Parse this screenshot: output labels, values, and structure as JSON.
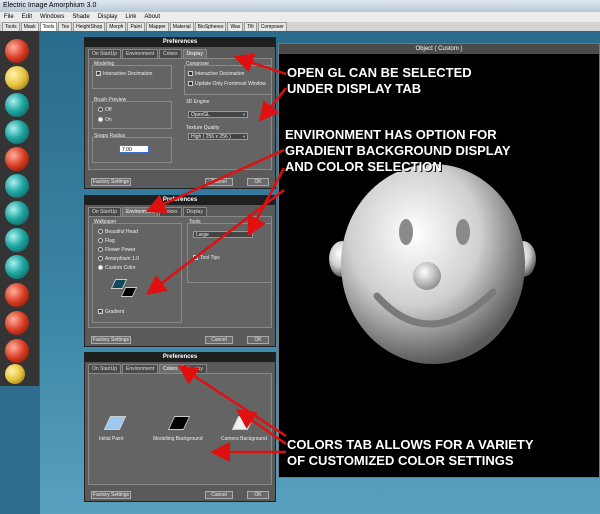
{
  "window": {
    "title": "Electric Image Amorphium 3.0"
  },
  "menu": [
    "File",
    "Edit",
    "Windows",
    "Shade",
    "Display",
    "Link",
    "About"
  ],
  "toolbar_tabs": [
    "Tools",
    "Mask",
    "Tools",
    "Tex",
    "HeightShop",
    "Morph",
    "Paint",
    "Mapper",
    "Material",
    "BioSpheres",
    "Wax",
    "Tilt",
    "Composer"
  ],
  "viewport": {
    "title": "Object ( Custom )"
  },
  "dialog_title": "Preferences",
  "tabs": {
    "startup": "On StartUp",
    "environment": "Environment",
    "colors": "Colors",
    "display": "Display"
  },
  "display_panel": {
    "modeling_label": "Modeling",
    "interactive_decimation": "Interactive Decimation",
    "composer_label": "Composer",
    "update_frontmost": "Update Only Frontmost Window",
    "brush_preview_label": "Brush Preview",
    "off": "Off",
    "on": "On",
    "engine_label": "3D Engine",
    "engine_value": "OpenGL",
    "texture_label": "Texture Quality",
    "texture_value": "High ( 256 x 256 )",
    "snaps_label": "Snaps Radius",
    "snaps_value": "7.00"
  },
  "environment_panel": {
    "wallpaper_label": "Wallpaper",
    "options": [
      "Beautiful Head",
      "Flag",
      "Flower Power",
      "Amorphium 1.0",
      "Custom Color"
    ],
    "gradient": "Gradient",
    "tools_label": "Tools",
    "tools_value": "Large",
    "tool_tips": "Tool Tips"
  },
  "colors_panel": {
    "items": [
      "Initial Paint",
      "Modelling Background",
      "Camera Background"
    ]
  },
  "buttons": {
    "factory": "Factory Settings",
    "cancel": "Cancel",
    "ok": "OK"
  },
  "annotations": {
    "a1_l1": "OPEN GL CAN BE SELECTED",
    "a1_l2": "UNDER DISPLAY TAB",
    "a2_l1": "ENVIRONMENT HAS OPTION FOR",
    "a2_l2": "GRADIENT BACKGROUND DISPLAY",
    "a2_l3": "AND COLOR SELECTION",
    "a3_l1": "COLORS TAB ALLOWS FOR A VARIETY",
    "a3_l2": "OF CUSTOMIZED COLOR SETTINGS"
  },
  "colors": {
    "arrow": "#e01010",
    "swatch_initial": "#9ec8f0",
    "swatch_model_bg": "#000000",
    "swatch_camera_bg": "#f0f0f0",
    "gradient_swatch": "#124a5a"
  }
}
